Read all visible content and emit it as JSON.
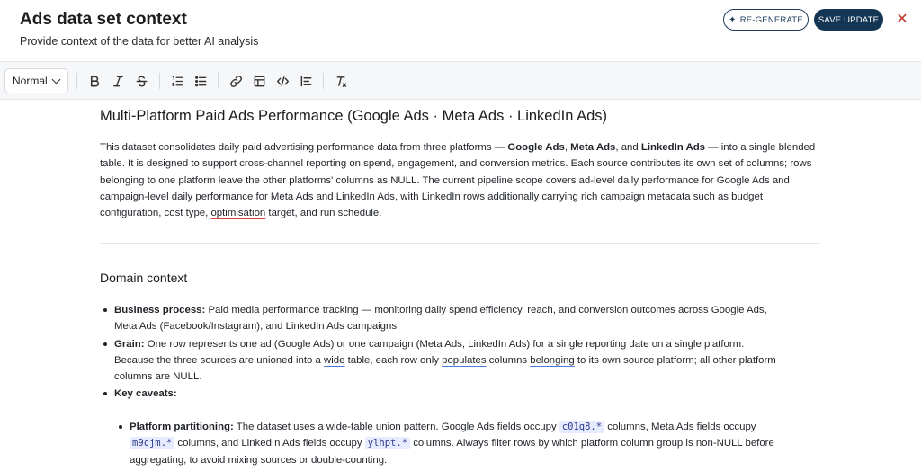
{
  "header": {
    "title": "Ads data set context",
    "subtitle": "Provide context of the data for better AI analysis",
    "regenerate_label": "RE-GENERATE",
    "save_label": "SAVE UPDATE",
    "close_glyph": "✕"
  },
  "toolbar": {
    "format_value": "Normal"
  },
  "doc": {
    "title": "Multi-Platform Paid Ads Performance (Google Ads · Meta Ads · LinkedIn Ads)",
    "p1_a": "This dataset consolidates daily paid advertising performance data from three platforms — ",
    "p1_g": "Google Ads",
    "p1_c1": ", ",
    "p1_m": "Meta Ads",
    "p1_c2": ", and ",
    "p1_l": "LinkedIn Ads",
    "p1_b": " — into a single blended table. It is designed to support cross-channel reporting on spend, engagement, and conversion metrics. Each source contributes its own set of columns; rows belonging to one platform leave the other platforms' columns as NULL. The current pipeline scope covers ad-level daily performance for Google Ads and campaign-level daily performance for Meta Ads and LinkedIn Ads, with LinkedIn rows additionally carrying rich campaign metadata such as budget configuration, cost type, ",
    "p1_spell": "optimisation",
    "p1_end": " target, and run schedule.",
    "domain_heading": "Domain context",
    "b1_label": "Business process:",
    "b1_text": " Paid media performance tracking — monitoring daily spend efficiency, reach, and conversion outcomes across Google Ads, Meta Ads (Facebook/Instagram), and LinkedIn Ads campaigns.",
    "b2_label": "Grain:",
    "b2_text_a": " One row represents one ad (Google Ads) or one campaign (Meta Ads, LinkedIn Ads) for a single reporting date on a single platform. Because the three sources are unioned into a ",
    "b2_wide": "wide",
    "b2_text_b": " table, each row only ",
    "b2_populates": "populates",
    "b2_text_c": " columns ",
    "b2_belonging": "belonging",
    "b2_text_d": " to its own source platform; all other platform columns are NULL.",
    "b3_label": "Key caveats:",
    "s1_label": "Platform partitioning:",
    "s1_a": " The dataset uses a wide-table union pattern. Google Ads fields occupy ",
    "s1_code1": "c01q8.*",
    "s1_b": " columns, Meta Ads fields occupy ",
    "s1_code2": "m9cjm.*",
    "s1_c": " columns, and LinkedIn Ads fields ",
    "s1_occupy": "occupy",
    "s1_code3": "ylhpt.*",
    "s1_d": " columns. Always filter rows by which platform column group is non-NULL before aggregating, to avoid mixing sources or double-counting."
  }
}
